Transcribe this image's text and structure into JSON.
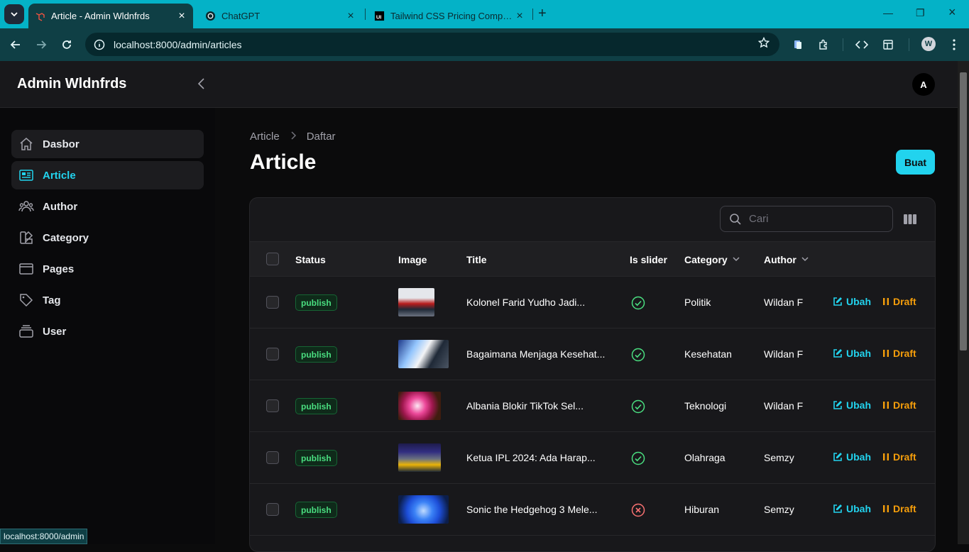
{
  "browser": {
    "tabs": [
      {
        "title": "Article - Admin Wldnfrds",
        "active": true
      },
      {
        "title": "ChatGPT",
        "active": false
      },
      {
        "title": "Tailwind CSS Pricing Componen",
        "active": false
      }
    ],
    "url": "localhost:8000/admin/articles",
    "profile_initial": "W",
    "status_url": "localhost:8000/admin"
  },
  "app": {
    "brand": "Admin Wldnfrds",
    "user_initial": "A"
  },
  "sidebar": {
    "items": [
      {
        "label": "Dasbor",
        "icon": "home-icon"
      },
      {
        "label": "Article",
        "icon": "newspaper-icon",
        "active": true
      },
      {
        "label": "Author",
        "icon": "users-icon"
      },
      {
        "label": "Category",
        "icon": "swatch-icon"
      },
      {
        "label": "Pages",
        "icon": "window-icon"
      },
      {
        "label": "Tag",
        "icon": "tag-icon"
      },
      {
        "label": "User",
        "icon": "stack-icon"
      }
    ]
  },
  "page": {
    "breadcrumb": [
      "Article",
      "Daftar"
    ],
    "title": "Article",
    "create_label": "Buat"
  },
  "table": {
    "search_placeholder": "Cari",
    "columns": [
      "Status",
      "Image",
      "Title",
      "Is slider",
      "Category",
      "Author"
    ],
    "edit_label": "Ubah",
    "draft_label": "Draft",
    "rows": [
      {
        "status": "publish",
        "title": "Kolonel Farid Yudho Jadi...",
        "is_slider": true,
        "category": "Politik",
        "author": "Wildan F"
      },
      {
        "status": "publish",
        "title": "Bagaimana Menjaga Kesehat...",
        "is_slider": true,
        "category": "Kesehatan",
        "author": "Wildan F"
      },
      {
        "status": "publish",
        "title": "Albania Blokir TikTok Sel...",
        "is_slider": true,
        "category": "Teknologi",
        "author": "Wildan F"
      },
      {
        "status": "publish",
        "title": "Ketua IPL 2024: Ada Harap...",
        "is_slider": true,
        "category": "Olahraga",
        "author": "Semzy"
      },
      {
        "status": "publish",
        "title": "Sonic the Hedgehog 3 Mele...",
        "is_slider": false,
        "category": "Hiburan",
        "author": "Semzy"
      }
    ]
  },
  "colors": {
    "accent": "#22d3ee",
    "draft": "#f59e0b",
    "success": "#4ade80",
    "danger": "#f87171"
  }
}
